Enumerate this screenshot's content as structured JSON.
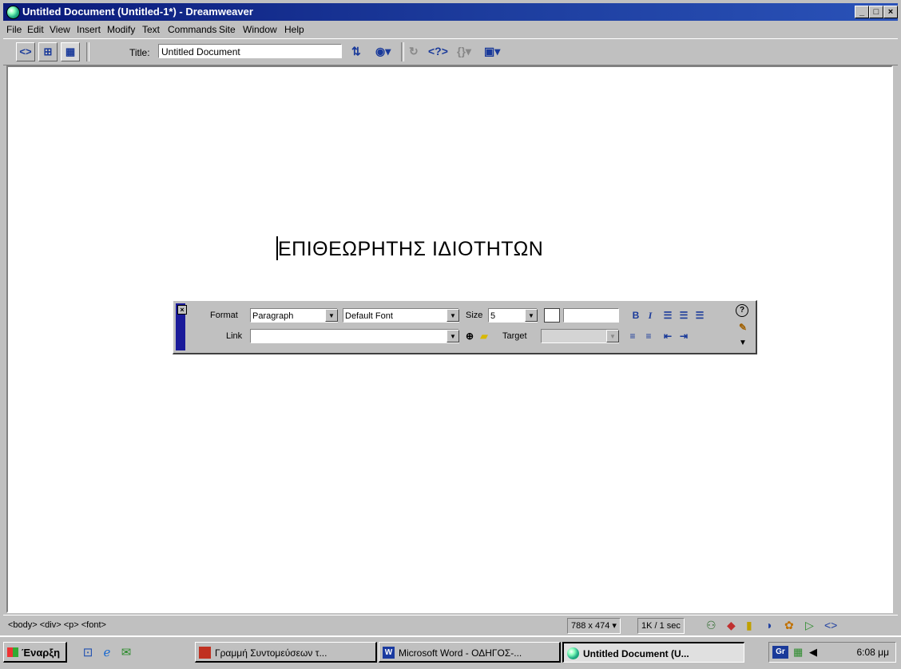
{
  "window": {
    "title": "Untitled Document (Untitled-1*) - Dreamweaver",
    "minimize": "_",
    "maximize": "□",
    "close": "×"
  },
  "menu": [
    {
      "label": "File"
    },
    {
      "label": "Edit"
    },
    {
      "label": "View"
    },
    {
      "label": "Insert"
    },
    {
      "label": "Modify"
    },
    {
      "label": "Text"
    },
    {
      "label": "Commands"
    },
    {
      "label": "Site"
    },
    {
      "label": "Window"
    },
    {
      "label": "Help"
    }
  ],
  "toolbar": {
    "title_label": "Title:",
    "title_value": "Untitled Document",
    "icons": [
      "show-code-view",
      "show-code-and-design-views",
      "show-design-view",
      "file-management",
      "preview-in-browser",
      "refresh",
      "reference",
      "code-navigation",
      "view-options"
    ]
  },
  "document": {
    "heading": "ΕΠΙΘΕΩΡΗΤΗΣ ΙΔΙΟΤΗΤΩΝ"
  },
  "properties": {
    "format_label": "Format",
    "format_value": "Paragraph",
    "font_value": "Default Font",
    "size_label": "Size",
    "size_value": "5",
    "link_label": "Link",
    "link_value": "",
    "target_label": "Target",
    "target_value": "",
    "bold": "B",
    "italic": "I",
    "help": "?"
  },
  "status": {
    "tag_selector": "<body> <div> <p> <font>",
    "window_size": "788 x 474",
    "download": "1K / 1 sec"
  },
  "taskbar": {
    "start_label": "Έναρξη",
    "tasks": [
      {
        "label": "Γραμμή Συντομεύσεων τ...",
        "active": false
      },
      {
        "label": "Microsoft Word - ΟΔΗΓΟΣ-...",
        "active": false
      },
      {
        "label": "Untitled Document (U...",
        "active": true
      }
    ],
    "language": "Gr",
    "clock": "6:08 μμ"
  }
}
